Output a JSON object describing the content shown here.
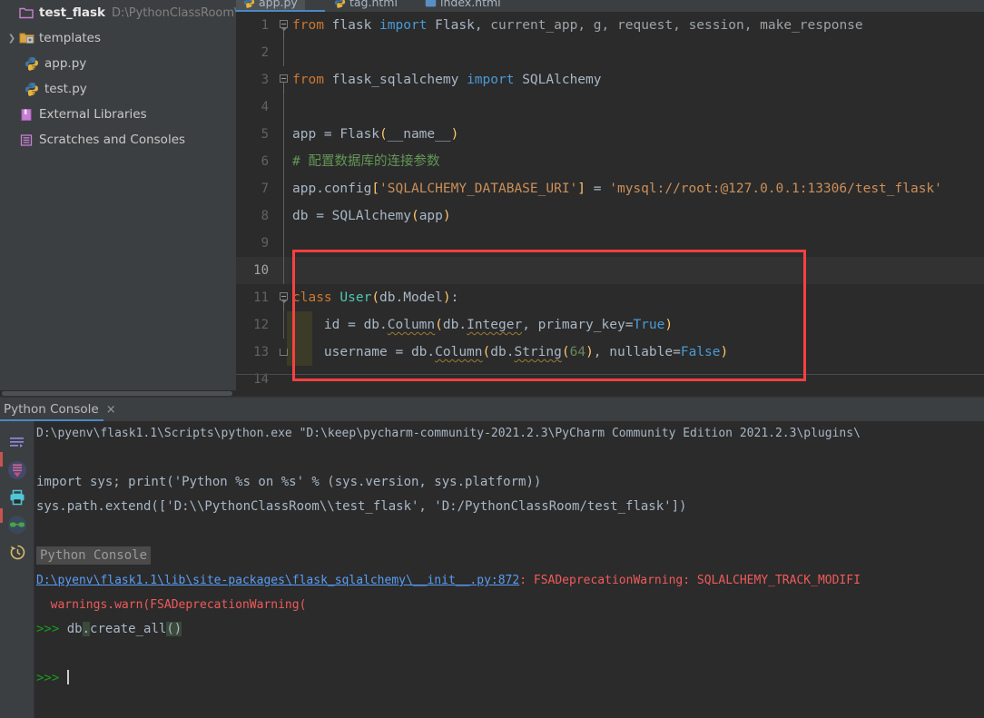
{
  "project_tree": {
    "items": [
      {
        "label": "test_flask",
        "path": "D:\\PythonClassRoom\\test_flask",
        "icon": "folder-project-icon",
        "arrow": "",
        "level": 1,
        "bold": true
      },
      {
        "label": "templates",
        "path": "",
        "icon": "folder-templates-icon",
        "arrow": "›",
        "level": 1,
        "bold": false
      },
      {
        "label": "app.py",
        "path": "",
        "icon": "python-file-icon",
        "arrow": "",
        "level": 2,
        "bold": false
      },
      {
        "label": "test.py",
        "path": "",
        "icon": "python-file-icon",
        "arrow": "",
        "level": 2,
        "bold": false
      },
      {
        "label": "External Libraries",
        "path": "",
        "icon": "library-icon",
        "arrow": "",
        "level": 1,
        "bold": false
      },
      {
        "label": "Scratches and Consoles",
        "path": "",
        "icon": "scratches-icon",
        "arrow": "",
        "level": 1,
        "bold": false
      }
    ]
  },
  "editor": {
    "tabs": [
      {
        "label": "app.py",
        "icon": "python-file-icon",
        "active": true
      },
      {
        "label": "tag.html",
        "icon": "python-file-icon",
        "active": false
      },
      {
        "label": "index.html",
        "icon": "html-file-icon",
        "active": false
      }
    ],
    "current_line": 10,
    "lines": [
      {
        "num": "1",
        "fold": "start-tri"
      },
      {
        "num": "2",
        "fold": "line"
      },
      {
        "num": "3",
        "fold": "start"
      },
      {
        "num": "4",
        "fold": ""
      },
      {
        "num": "5",
        "fold": ""
      },
      {
        "num": "6",
        "fold": ""
      },
      {
        "num": "7",
        "fold": ""
      },
      {
        "num": "8",
        "fold": ""
      },
      {
        "num": "9",
        "fold": ""
      },
      {
        "num": "10",
        "fold": ""
      },
      {
        "num": "11",
        "fold": "start-tri"
      },
      {
        "num": "12",
        "fold": "line"
      },
      {
        "num": "13",
        "fold": "end"
      },
      {
        "num": "14",
        "fold": ""
      }
    ],
    "code_text": {
      "l1": "from flask import Flask, current_app, g, request, session, make_response",
      "l3": "from flask_sqlalchemy import SQLAlchemy",
      "l5": "app = Flask(__name__)",
      "l6": "# 配置数据库的连接参数",
      "l7": "app.config['SQLALCHEMY_DATABASE_URI'] = 'mysql://root:@127.0.0.1:13306/test_flask'",
      "l8": "db = SQLAlchemy(app)",
      "l11": "class User(db.Model):",
      "l12": "    id = db.Column(db.Integer, primary_key=True)",
      "l13": "    username = db.Column(db.String(64), nullable=False)"
    },
    "tokens": {
      "kw_from": "from",
      "kw_import": "import",
      "kw_class": "class",
      "mod_flask": "flask",
      "mod_flask_sqlalchemy": "flask_sqlalchemy",
      "name_Flask": "Flask",
      "name_SQLAlchemy": "SQLAlchemy",
      "imports_rest": "Flask, current_app, g, request, session, make_response",
      "app_assign": "app = Flask(__name__)",
      "comment_cn": "# 配置数据库的连接参数",
      "config_key": "'SQLALCHEMY_DATABASE_URI'",
      "config_value": "'mysql://root:@127.0.0.1:13306/test_flask'",
      "db_assign": "db = SQLAlchemy(app)",
      "class_name": "User",
      "class_base": "db.Model",
      "field_id": "id",
      "field_username": "username",
      "db_dot": "db.",
      "Column": "Column",
      "Integer": "Integer",
      "String": "String",
      "str_len": "64",
      "primary_key": "primary_key",
      "nullable": "nullable",
      "True": "True",
      "False": "False"
    },
    "annotation_box": {
      "color": "#fc4040",
      "covers_lines": "10-14"
    }
  },
  "console": {
    "tab_label": "Python Console",
    "close_label": "×",
    "toolbar_icons": [
      "soft-wrap-icon",
      "scroll-to-end-icon",
      "print-icon",
      "show-variables-icon",
      "command-history-icon"
    ],
    "output": {
      "line1": "D:\\pyenv\\flask1.1\\Scripts\\python.exe \"D:\\keep\\pycharm-community-2021.2.3\\PyCharm Community Edition 2021.2.3\\plugins\\",
      "line2": "import sys; print('Python %s on %s' % (sys.version, sys.platform))",
      "line3": "sys.path.extend(['D:\\\\PythonClassRoom\\\\test_flask', 'D:/PythonClassRoom/test_flask'])",
      "line4": "Python Console",
      "line5_link": "D:\\pyenv\\flask1.1\\lib\\site-packages\\flask_sqlalchemy\\__init__.py:872",
      "line5_rest": ": FSADeprecationWarning: SQLALCHEMY_TRACK_MODIFI",
      "line6": "  warnings.warn(FSADeprecationWarning(",
      "prompt": ">>>",
      "cmd_prefix": "db",
      "cmd_dot": ".",
      "cmd_name": "create_all",
      "cmd_parens": "()",
      "prompt_empty": ">>>"
    }
  },
  "colors": {
    "accent_blue": "#4a88c7",
    "annotation_red": "#fc4040",
    "editor_bg": "#2b2b2b",
    "panel_bg": "#3c3f41",
    "keyword_orange": "#cc7832",
    "string_brown": "#cb8f5a",
    "comment_green": "#629755",
    "error_red": "#f05a5a"
  }
}
